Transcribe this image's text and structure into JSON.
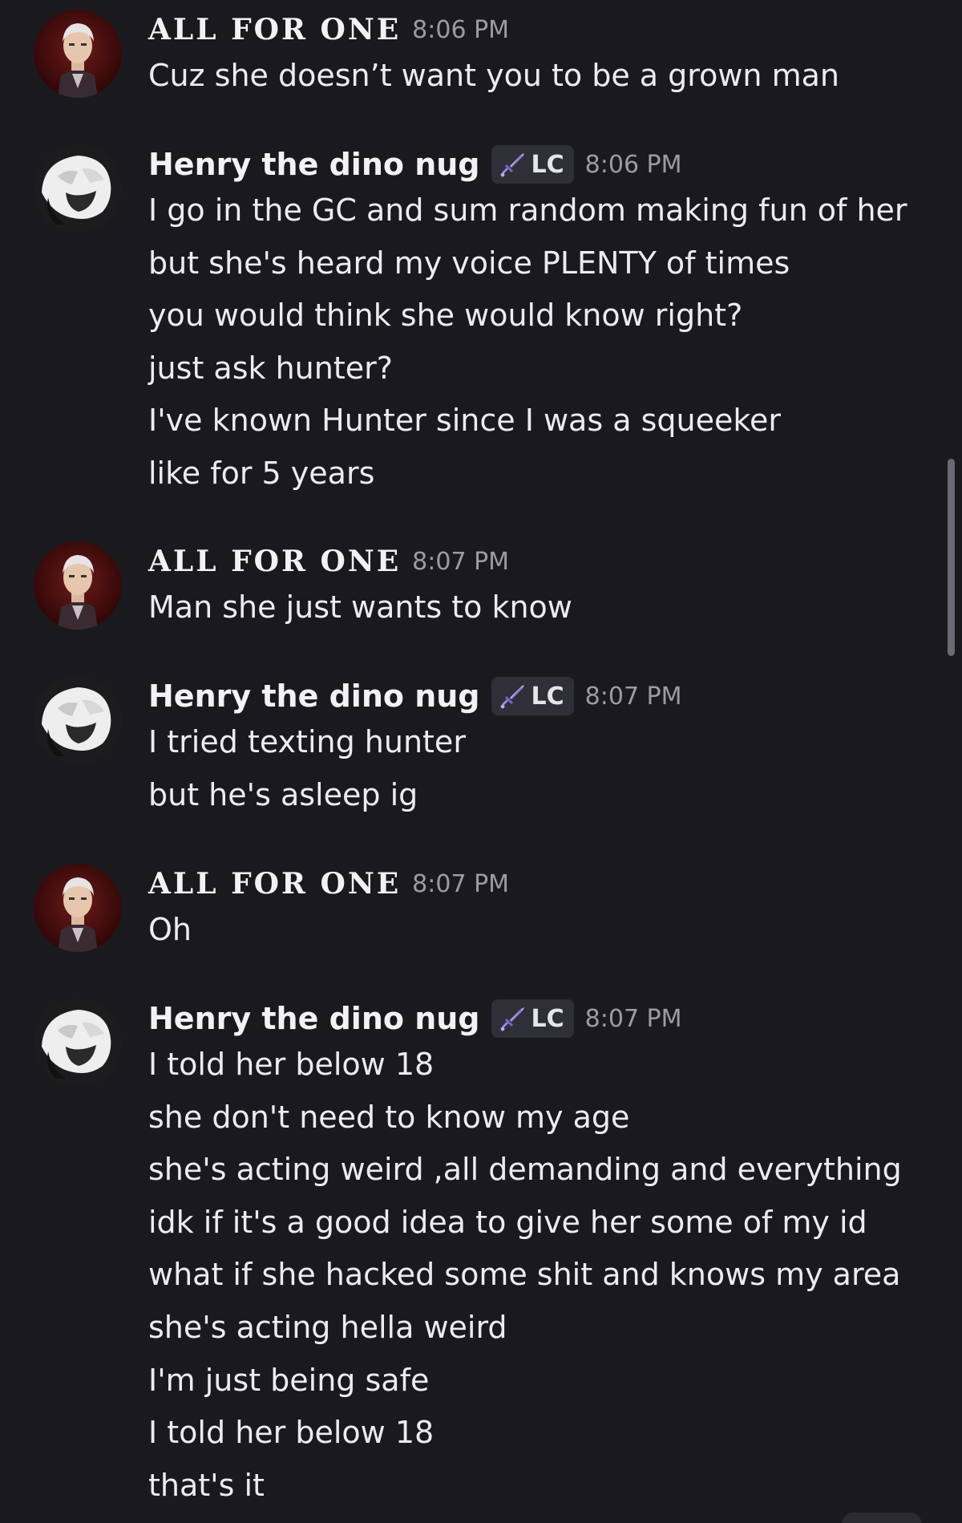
{
  "messages": [
    {
      "author": "ALL FOR ONE",
      "avatar": "afo-avatar",
      "tag": null,
      "time": "8:06 PM",
      "lines": [
        "Cuz she doesn’t want you to be a grown man"
      ]
    },
    {
      "author": "Henry the dino nug",
      "avatar": "henry-avatar",
      "tag": {
        "icon": "sword-icon",
        "label": "LC"
      },
      "time": "8:06 PM",
      "lines": [
        "I go in the GC and sum random making fun of her",
        "but she's heard my voice PLENTY of times",
        "you would think she would know right?",
        "just ask hunter?",
        "I've known Hunter since I was a squeeker",
        "like for 5 years"
      ]
    },
    {
      "author": "ALL FOR ONE",
      "avatar": "afo-avatar",
      "tag": null,
      "time": "8:07 PM",
      "lines": [
        "Man she just wants to know"
      ]
    },
    {
      "author": "Henry the dino nug",
      "avatar": "henry-avatar",
      "tag": {
        "icon": "sword-icon",
        "label": "LC"
      },
      "time": "8:07 PM",
      "lines": [
        "I tried texting hunter",
        "but he's asleep ig"
      ]
    },
    {
      "author": "ALL FOR ONE",
      "avatar": "afo-avatar",
      "tag": null,
      "time": "8:07 PM",
      "lines": [
        "Oh"
      ]
    },
    {
      "author": "Henry the dino nug",
      "avatar": "henry-avatar",
      "tag": {
        "icon": "sword-icon",
        "label": "LC"
      },
      "time": "8:07 PM",
      "lines": [
        "I told her below 18",
        "she don't need to know my age",
        "she's acting weird ,all demanding and everything",
        "idk if it's a good idea to give her some of my id",
        "what if she hacked some shit and knows my area",
        "she's acting hella weird",
        "I'm just being safe",
        "I told her below 18",
        "that's it"
      ]
    }
  ],
  "colors": {
    "background": "#1a1a1e",
    "text": "#ececf0",
    "timestamp": "#9b9ba5",
    "tag_bg": "#2f2f38",
    "sword": "#9b7fe0"
  }
}
